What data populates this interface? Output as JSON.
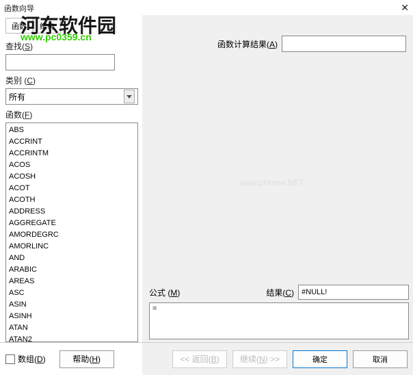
{
  "window": {
    "title": "函数向导",
    "close": "✕"
  },
  "tabs": {
    "func": "函数",
    "struct": "结构"
  },
  "left": {
    "search_label_pre": "查找(",
    "search_label_u": "S",
    "search_label_post": ")",
    "category_label_pre": "类别 (",
    "category_label_u": "C",
    "category_label_post": ")",
    "category_value": "所有",
    "func_label_pre": "函数(",
    "func_label_u": "F",
    "func_label_post": ")",
    "functions": [
      "ABS",
      "ACCRINT",
      "ACCRINTM",
      "ACOS",
      "ACOSH",
      "ACOT",
      "ACOTH",
      "ADDRESS",
      "AGGREGATE",
      "AMORDEGRC",
      "AMORLINC",
      "AND",
      "ARABIC",
      "AREAS",
      "ASC",
      "ASIN",
      "ASINH",
      "ATAN",
      "ATAN2"
    ]
  },
  "right": {
    "calc_result_label_pre": "函数计算结果(",
    "calc_result_label_u": "A",
    "calc_result_label_post": ")",
    "formula_label_pre": "公式 (",
    "formula_label_u": "M",
    "formula_label_post": ")",
    "result_label_pre": "结果(",
    "result_label_u": "C",
    "result_label_post": ")",
    "result_value": "#NULL!",
    "formula_value": "="
  },
  "footer": {
    "array_label_pre": "数组(",
    "array_label_u": "D",
    "array_label_post": ")",
    "help_pre": "帮助(",
    "help_u": "H",
    "help_post": ")",
    "back_pre": "<< 返回(",
    "back_u": "B",
    "back_post": ")",
    "next_pre": "继续(",
    "next_u": "N",
    "next_post": ") >>",
    "ok": "确定",
    "cancel": "取消"
  },
  "watermark": {
    "brand": "河东软件园",
    "url": "www.pc0359.cn",
    "center": "www.pHome.NET"
  }
}
